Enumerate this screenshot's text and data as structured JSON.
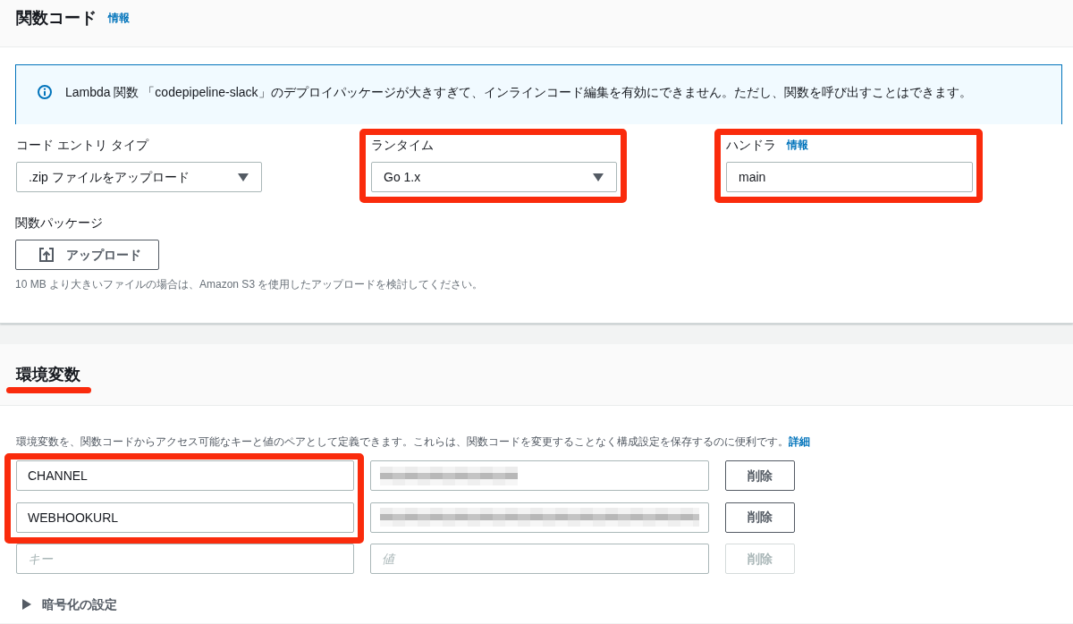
{
  "section_code": {
    "title": "関数コード",
    "info_link": "情報",
    "alert": {
      "kind": "info",
      "text": "Lambda 関数 「codepipeline-slack」のデプロイパッケージが大きすぎて、インラインコード編集を有効にできません。ただし、関数を呼び出すことはできます。"
    },
    "fields": [
      {
        "kind": "select",
        "label": "コード エントリ タイプ",
        "value": ".zip ファイルをアップロード",
        "highlighted": false
      },
      {
        "kind": "select",
        "label": "ランタイム",
        "value": "Go 1.x",
        "highlighted": true
      },
      {
        "kind": "text",
        "label": "ハンドラ",
        "info_link": "情報",
        "value": "main",
        "highlighted": true
      }
    ],
    "package": {
      "label": "関数パッケージ",
      "button": "アップロード",
      "hint": "10 MB より大きいファイルの場合は、Amazon S3 を使用したアップロードを検討してください。"
    }
  },
  "section_env": {
    "title": "環境変数",
    "title_underlined": true,
    "description": "環境変数を、関数コードからアクセス可能なキーと値のペアとして定義できます。これらは、関数コードを変更することなく構成設定を保存するのに便利です。",
    "details_link": "詳細",
    "variables": [
      {
        "kind": "short",
        "key": "CHANNEL",
        "value_redacted": true,
        "delete_label": "削除",
        "highlighted": true
      },
      {
        "kind": "long",
        "key": "WEBHOOKURL",
        "value_redacted": true,
        "delete_label": "削除",
        "highlighted": true
      }
    ],
    "new_row": {
      "key_placeholder": "キー",
      "value_placeholder": "値",
      "delete_label": "削除",
      "disabled": true
    },
    "encryption": {
      "label": "暗号化の設定",
      "expanded": false
    }
  }
}
